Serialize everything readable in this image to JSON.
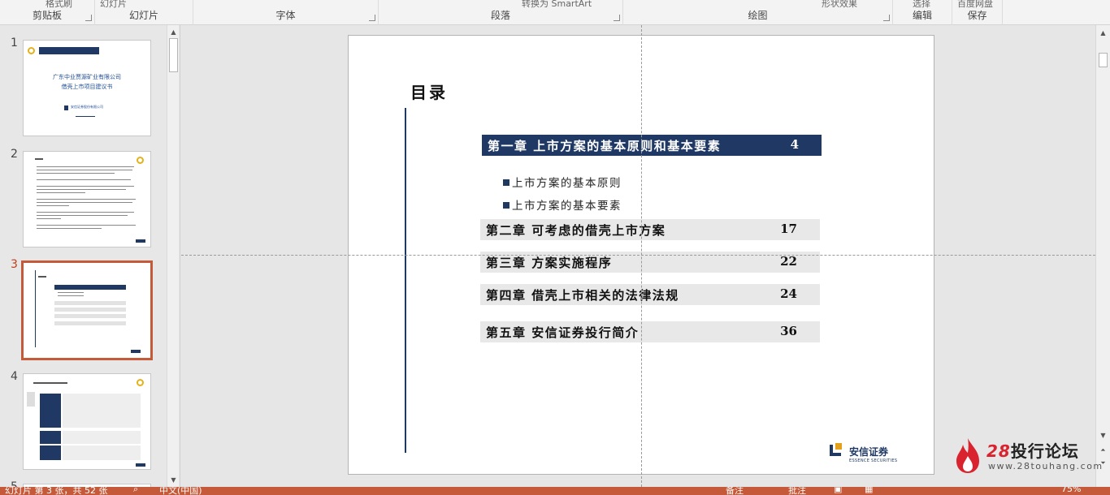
{
  "ribbon": {
    "groups": [
      {
        "label": "剪贴板",
        "cut_text": "格式刷"
      },
      {
        "label": "幻灯片",
        "cut_text": "幻灯片"
      },
      {
        "label": "字体",
        "cut_text": ""
      },
      {
        "label": "段落",
        "cut_text": "转换为 SmartArt"
      },
      {
        "label": "绘图",
        "cut_text": "形状效果"
      },
      {
        "label": "编辑",
        "cut_text": "选择"
      },
      {
        "label": "保存",
        "cut_text": "百度网盘"
      }
    ]
  },
  "thumbnails": {
    "selected": 3,
    "items": [
      {
        "number": "1",
        "line1": "广东中业贾源矿业有限公司",
        "line2": "借壳上市项目建议书",
        "brand": "安信证券股份有限公司"
      },
      {
        "number": "2"
      },
      {
        "number": "3"
      },
      {
        "number": "4"
      },
      {
        "number": "5"
      }
    ]
  },
  "slide": {
    "title": "目录",
    "chapters": [
      {
        "title": "第一章  上市方案的基本原则和基本要素",
        "page": "4"
      },
      {
        "title": "第二章 可考虑的借壳上市方案",
        "page": "17"
      },
      {
        "title": "第三章 方案实施程序",
        "page": "22"
      },
      {
        "title": "第四章 借壳上市相关的法律法规",
        "page": "24"
      },
      {
        "title": "第五章 安信证券投行简介",
        "page": "36"
      }
    ],
    "subitems": [
      "上市方案的基本原则",
      "上市方案的基本要素"
    ],
    "logo": {
      "name": "安信证券",
      "sub": "ESSENCE SECURITIES"
    }
  },
  "watermark": {
    "num": "28",
    "text": "投行论坛",
    "url": "www.28touhang.com"
  },
  "status": {
    "slide_info": "幻灯片 第 3 张，共 52 张",
    "language": "中文(中国)",
    "notes": "备注",
    "comments": "批注",
    "zoom": "75%"
  },
  "colors": {
    "accent": "#c55a3a",
    "navy": "#1f3864"
  }
}
